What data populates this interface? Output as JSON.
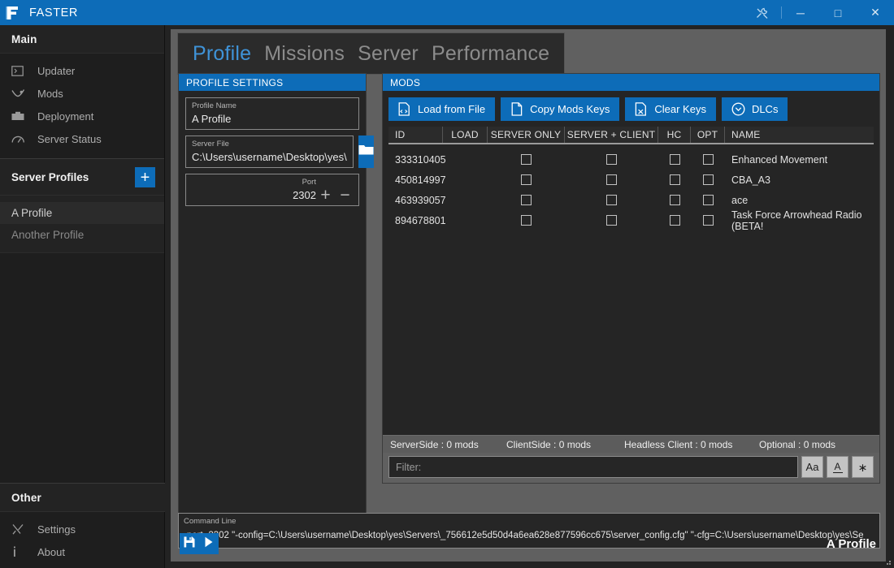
{
  "titlebar": {
    "app_title": "FASTER",
    "logo_icon": "faster-f-logo",
    "tools_icon": "wrench-screwdriver-icon",
    "minimize_label": "─",
    "maximize_label": "□",
    "close_label": "✕"
  },
  "sidebar": {
    "main_heading": "Main",
    "main_items": [
      {
        "label": "Updater",
        "icon": "terminal-icon"
      },
      {
        "label": "Mods",
        "icon": "steam-icon"
      },
      {
        "label": "Deployment",
        "icon": "briefcase-icon"
      },
      {
        "label": "Server Status",
        "icon": "gauge-icon"
      }
    ],
    "profiles_heading": "Server Profiles",
    "add_profile_label": "+",
    "profiles": [
      {
        "label": "A Profile",
        "selected": true
      },
      {
        "label": "Another Profile",
        "selected": false
      }
    ],
    "other_heading": "Other",
    "other_items": [
      {
        "label": "Settings",
        "icon": "tools-icon"
      },
      {
        "label": "About",
        "icon": "info-icon"
      }
    ]
  },
  "tabs": [
    {
      "label": "Profile",
      "active": true
    },
    {
      "label": "Missions",
      "active": false
    },
    {
      "label": "Server",
      "active": false
    },
    {
      "label": "Performance",
      "active": false
    }
  ],
  "profile_settings": {
    "header": "PROFILE SETTINGS",
    "profile_name_label": "Profile Name",
    "profile_name_value": "A Profile",
    "server_file_label": "Server File",
    "server_file_value": "C:\\Users\\username\\Desktop\\yes\\",
    "browse_icon": "folder-icon",
    "port_label": "Port",
    "port_value": "2302",
    "port_increment": "+",
    "port_decrement": "−"
  },
  "mods": {
    "header": "MODS",
    "toolbar": [
      {
        "label": "Load from File",
        "icon": "file-load-icon"
      },
      {
        "label": "Copy Mods Keys",
        "icon": "file-copy-icon"
      },
      {
        "label": "Clear Keys",
        "icon": "file-clear-icon"
      },
      {
        "label": "DLCs",
        "icon": "chevron-down-circle-icon"
      }
    ],
    "columns": [
      "ID",
      "LOAD",
      "SERVER ONLY",
      "SERVER + CLIENT",
      "HC",
      "OPT",
      "NAME"
    ],
    "rows": [
      {
        "id": "333310405",
        "load": false,
        "server_only": false,
        "server_client": false,
        "hc": false,
        "opt": false,
        "name": "Enhanced Movement"
      },
      {
        "id": "450814997",
        "load": false,
        "server_only": false,
        "server_client": false,
        "hc": false,
        "opt": false,
        "name": "CBA_A3"
      },
      {
        "id": "463939057",
        "load": false,
        "server_only": false,
        "server_client": false,
        "hc": false,
        "opt": false,
        "name": "ace"
      },
      {
        "id": "894678801",
        "load": false,
        "server_only": false,
        "server_client": false,
        "hc": false,
        "opt": false,
        "name": "Task Force Arrowhead Radio (BETA!"
      }
    ],
    "counts": [
      "ServerSide : 0 mods",
      "ClientSide : 0 mods",
      "Headless Client : 0 mods",
      "Optional : 0 mods"
    ],
    "filter_placeholder": "Filter:",
    "filter_value": "",
    "filter_buttons": [
      {
        "label": "Aa",
        "name": "match-case-button"
      },
      {
        "label": "A",
        "name": "match-word-button"
      },
      {
        "label": ".*",
        "name": "regex-button"
      }
    ]
  },
  "command_line": {
    "label": "Command Line",
    "value": "-port=2302 \"-config=C:\\Users\\username\\Desktop\\yes\\Servers\\_756612e5d50d4a6ea628e877596cc675\\server_config.cfg\" \"-cfg=C:\\Users\\username\\Desktop\\yes\\Se"
  },
  "bottom_bar": {
    "save_icon": "save-icon",
    "play_icon": "play-icon",
    "profile_label": "A Profile"
  },
  "colors": {
    "accent": "#0d6cb8",
    "tab_active": "#3f93d8",
    "main_bg": "#606060",
    "panel_bg": "#252525",
    "sidebar_bg": "#1e1e1e"
  }
}
